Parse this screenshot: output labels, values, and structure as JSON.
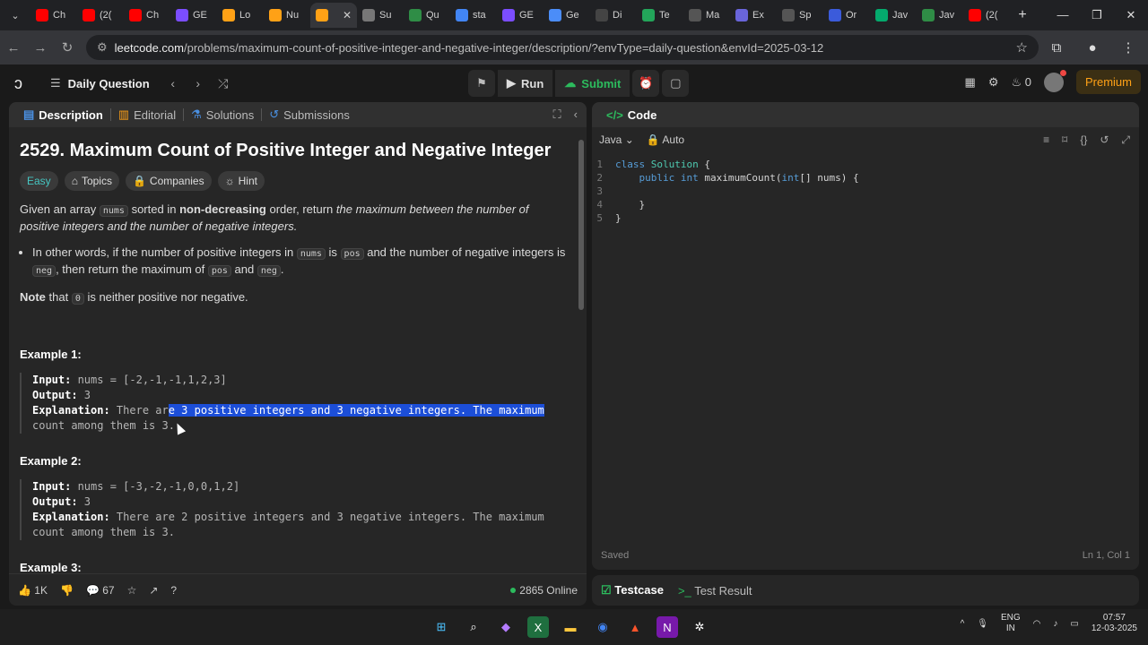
{
  "browser": {
    "tabs": [
      {
        "label": "Ch",
        "icon": "youtube-icon",
        "color": "#ff0000"
      },
      {
        "label": "(2(",
        "icon": "youtube-icon",
        "color": "#ff0000"
      },
      {
        "label": "Ch",
        "icon": "youtube-icon",
        "color": "#ff0000"
      },
      {
        "label": "GE",
        "icon": "bolt-icon",
        "color": "#7b4dff"
      },
      {
        "label": "Lo",
        "icon": "leetcode-icon",
        "color": "#ffa116"
      },
      {
        "label": "Nu",
        "icon": "leetcode-icon",
        "color": "#ffa116"
      },
      {
        "label": "",
        "icon": "leetcode-icon",
        "color": "#ffa116",
        "active": true
      },
      {
        "label": "Su",
        "icon": "openai-icon",
        "color": "#777"
      },
      {
        "label": "Qu",
        "icon": "gfg-icon",
        "color": "#2f8d46"
      },
      {
        "label": "sta",
        "icon": "google-icon",
        "color": "#4285f4"
      },
      {
        "label": "GE",
        "icon": "bolt-icon",
        "color": "#7b4dff"
      },
      {
        "label": "Ge",
        "icon": "gemini-icon",
        "color": "#4b8df8"
      },
      {
        "label": "Di",
        "icon": "d-icon",
        "color": "#444"
      },
      {
        "label": "Te",
        "icon": "tc-icon",
        "color": "#23a55a"
      },
      {
        "label": "Ma",
        "icon": "x-brand-icon",
        "color": "#555"
      },
      {
        "label": "Ex",
        "icon": "excalidraw-icon",
        "color": "#6965db"
      },
      {
        "label": "Sp",
        "icon": "spotify-icon",
        "color": "#555"
      },
      {
        "label": "Or",
        "icon": "oracle-icon",
        "color": "#3b5bdb"
      },
      {
        "label": "Jav",
        "icon": "w-icon",
        "color": "#04aa6d"
      },
      {
        "label": "Jav",
        "icon": "gfg-icon",
        "color": "#2f8d46"
      },
      {
        "label": "(2(",
        "icon": "youtube-icon",
        "color": "#ff0000"
      }
    ],
    "url_host": "leetcode.com",
    "url_path": "/problems/maximum-count-of-positive-integer-and-negative-integer/description/?envType=daily-question&envId=2025-03-12"
  },
  "lc_header": {
    "daily_label": "Daily Question",
    "run_label": "Run",
    "submit_label": "Submit",
    "streak": "0",
    "premium_label": "Premium"
  },
  "left_tabs": {
    "description": "Description",
    "editorial": "Editorial",
    "solutions": "Solutions",
    "submissions": "Submissions"
  },
  "problem": {
    "title": "2529. Maximum Count of Positive Integer and Negative Integer",
    "difficulty": "Easy",
    "topics": "Topics",
    "companies": "Companies",
    "hint": "Hint",
    "p1_a": "Given an array ",
    "p1_code": "nums",
    "p1_b": " sorted in ",
    "p1_bold": "non-decreasing",
    "p1_c": " order, return ",
    "p1_italic": "the maximum between the number of positive integers and the number of negative integers.",
    "li_a": "In other words, if the number of positive integers in ",
    "li_code1": "nums",
    "li_b": " is ",
    "li_code2": "pos",
    "li_c": " and the number of negative integers is ",
    "li_code3": "neg",
    "li_d": ", then return the maximum of ",
    "li_code4": "pos",
    "li_e": " and ",
    "li_code5": "neg",
    "li_f": ".",
    "note_bold": "Note",
    "note_a": " that ",
    "note_code": "0",
    "note_b": " is neither positive nor negative.",
    "ex1_head": "Example 1:",
    "ex1_in_label": "Input:",
    "ex1_in": " nums = [-2,-1,-1,1,2,3]",
    "ex1_out_label": "Output:",
    "ex1_out": " 3",
    "ex1_exp_label": "Explanation:",
    "ex1_exp_a": " There ar",
    "ex1_exp_hl": "e 3 positive integers and 3 negative integers. The maximum",
    "ex1_exp_b": "count among them is 3.",
    "ex2_head": "Example 2:",
    "ex2_in_label": "Input:",
    "ex2_in": " nums = [-3,-2,-1,0,0,1,2]",
    "ex2_out_label": "Output:",
    "ex2_out": " 3",
    "ex2_exp_label": "Explanation:",
    "ex2_exp_a": " There are 2 positive integers and 3 negative integers. The maximum",
    "ex2_exp_b": "count among them is 3.",
    "ex3_head": "Example 3:"
  },
  "left_footer": {
    "likes": "1K",
    "comments": "67",
    "online": "2865 Online"
  },
  "code_panel": {
    "title": "Code",
    "language": "Java",
    "mode": "Auto",
    "lines": [
      "1",
      "2",
      "3",
      "4",
      "5"
    ],
    "saved": "Saved",
    "position": "Ln 1, Col 1"
  },
  "code_text": {
    "l1_kw": "class",
    "l1_ty": " Solution",
    "l1_rest": " {",
    "l2_indent": "    ",
    "l2_kw": "public",
    "l2_ty": " int",
    "l2_rest": " maximumCount(",
    "l2_ty2": "int",
    "l2_rest2": "[] nums) {",
    "l3": "",
    "l4": "    }",
    "l5": "}"
  },
  "testcase": {
    "testcase_label": "Testcase",
    "result_label": "Test Result"
  },
  "taskbar": {
    "lang_1": "ENG",
    "lang_2": "IN",
    "time": "07:57",
    "date": "12-03-2025"
  }
}
